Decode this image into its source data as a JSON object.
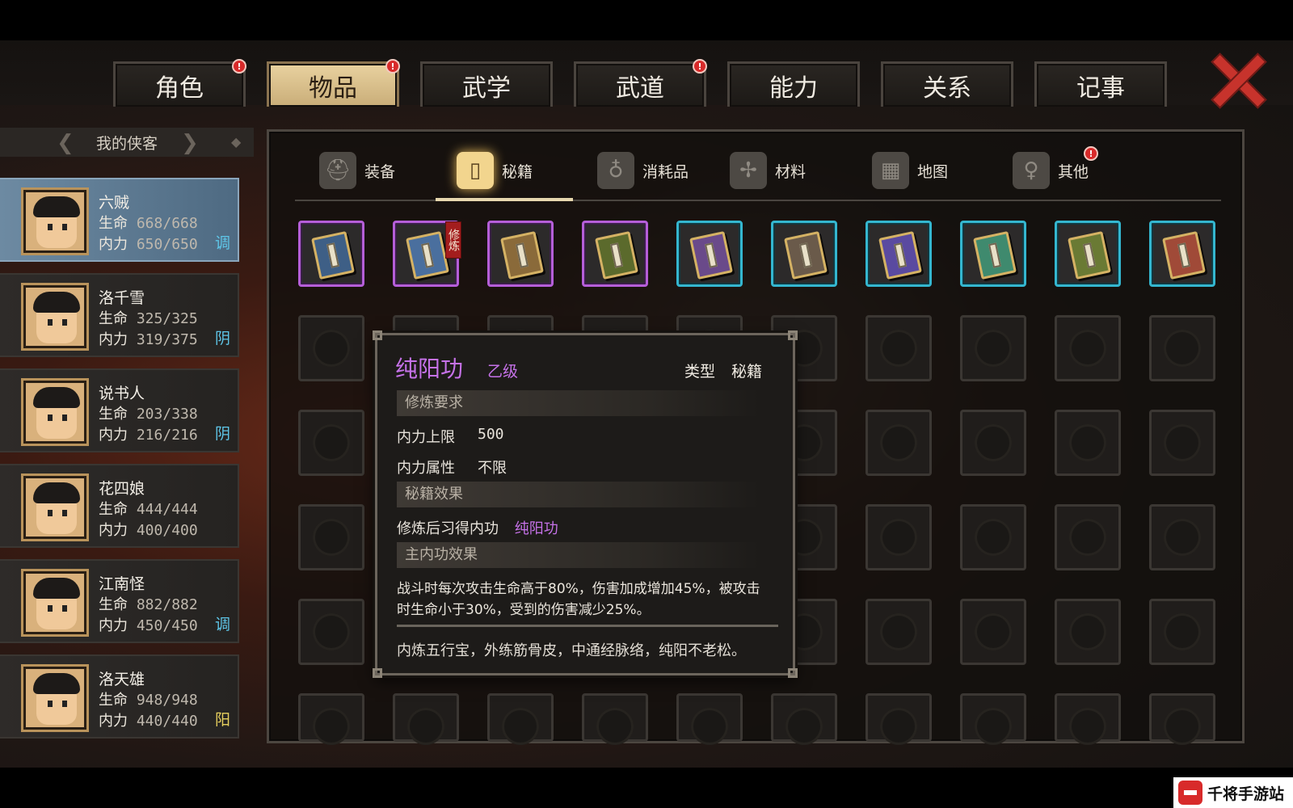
{
  "top_tabs": [
    {
      "label": "角色",
      "alert": true
    },
    {
      "label": "物品",
      "alert": true,
      "active": true
    },
    {
      "label": "武学",
      "alert": false
    },
    {
      "label": "武道",
      "alert": true
    },
    {
      "label": "能力",
      "alert": false
    },
    {
      "label": "关系",
      "alert": false
    },
    {
      "label": "记事",
      "alert": false
    }
  ],
  "alert_mark": "!",
  "left_panel": {
    "header": "我的侠客",
    "characters": [
      {
        "name": "六贼",
        "hp_label": "生命",
        "hp": "668/668",
        "mp_label": "内力",
        "mp": "650/650",
        "yinyang": "调",
        "selected": true
      },
      {
        "name": "洛千雪",
        "hp_label": "生命",
        "hp": "325/325",
        "mp_label": "内力",
        "mp": "319/375",
        "yinyang": "阴"
      },
      {
        "name": "说书人",
        "hp_label": "生命",
        "hp": "203/338",
        "mp_label": "内力",
        "mp": "216/216",
        "yinyang": "阴"
      },
      {
        "name": "花四娘",
        "hp_label": "生命",
        "hp": "444/444",
        "mp_label": "内力",
        "mp": "400/400",
        "yinyang": ""
      },
      {
        "name": "江南怪",
        "hp_label": "生命",
        "hp": "882/882",
        "mp_label": "内力",
        "mp": "450/450",
        "yinyang": "调"
      },
      {
        "name": "洛天雄",
        "hp_label": "生命",
        "hp": "948/948",
        "mp_label": "内力",
        "mp": "440/440",
        "yinyang": "阳"
      }
    ]
  },
  "colors": {
    "yin": "#5ec6e8",
    "tiao": "#5ec6e8",
    "yang": "#e8d15e",
    "purple": "#c672e9",
    "cyan": "#34b6cf"
  },
  "categories": [
    {
      "label": "装备",
      "icon": "armor-icon"
    },
    {
      "label": "秘籍",
      "icon": "scroll-book-icon",
      "active": true
    },
    {
      "label": "消耗品",
      "icon": "potion-icon"
    },
    {
      "label": "材料",
      "icon": "herb-root-icon"
    },
    {
      "label": "地图",
      "icon": "map-icon"
    },
    {
      "label": "其他",
      "icon": "misc-pendant-icon",
      "alert": true
    }
  ],
  "items": [
    {
      "rarity": "purple",
      "book_color": "#3e5f86"
    },
    {
      "rarity": "purple",
      "book_color": "#4a6f9e",
      "badge": "修炼"
    },
    {
      "rarity": "purple",
      "book_color": "#8a6a3a"
    },
    {
      "rarity": "purple",
      "book_color": "#5b6a2c"
    },
    {
      "rarity": "cyan",
      "book_color": "#6a4a8a"
    },
    {
      "rarity": "cyan",
      "book_color": "#6a5a4a"
    },
    {
      "rarity": "cyan",
      "book_color": "#5a4aa0"
    },
    {
      "rarity": "cyan",
      "book_color": "#3f8a6e"
    },
    {
      "rarity": "cyan",
      "book_color": "#6a7a34"
    },
    {
      "rarity": "cyan",
      "book_color": "#a04a38"
    }
  ],
  "tooltip": {
    "name": "纯阳功",
    "grade": "乙级",
    "type_label": "类型",
    "type_value": "秘籍",
    "section_req": "修炼要求",
    "req_rows": [
      {
        "label": "内力上限",
        "value": "500"
      },
      {
        "label": "内力属性",
        "value": "不限"
      }
    ],
    "section_effect": "秘籍效果",
    "effect_label": "修炼后习得内功",
    "effect_value": "纯阳功",
    "section_main": "主内功效果",
    "main_desc": "战斗时每次攻击生命高于80%，伤害加成增加45%，被攻击时生命小于30%，受到的伤害减少25%。",
    "flavor": "内炼五行宝，外练筋骨皮，中通经脉络，纯阳不老松。"
  },
  "watermark": "千将手游站"
}
